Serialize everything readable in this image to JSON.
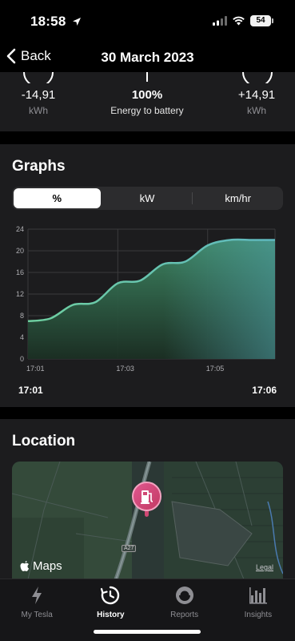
{
  "status_bar": {
    "time": "18:58",
    "battery": "54"
  },
  "nav": {
    "back_label": "Back",
    "title": "30 March 2023"
  },
  "summary": {
    "left": {
      "value": "-14,91",
      "unit": "kWh"
    },
    "center": {
      "value": "100%",
      "label": "Energy to battery"
    },
    "right": {
      "value": "+14,91",
      "unit": "kWh"
    }
  },
  "graphs": {
    "title": "Graphs",
    "segments": [
      "%",
      "kW",
      "km/hr"
    ],
    "selected_segment": "%",
    "range_start": "17:01",
    "range_end": "17:06"
  },
  "chart_data": {
    "type": "area",
    "x": [
      "17:01",
      "17:01:30",
      "17:02",
      "17:02:30",
      "17:03",
      "17:03:30",
      "17:04",
      "17:04:30",
      "17:05",
      "17:05:30",
      "17:06",
      "17:06:30"
    ],
    "values": [
      7,
      7.5,
      10,
      10.5,
      14,
      14.5,
      17.5,
      18,
      21,
      22,
      22,
      22
    ],
    "x_ticks": [
      "17:01",
      "17:03",
      "17:05"
    ],
    "y_ticks": [
      "0",
      "4",
      "8",
      "12",
      "16",
      "20",
      "24"
    ],
    "ylim": [
      0,
      24
    ],
    "grid": true,
    "colors": {
      "line": "#6fd0a0",
      "fill_top": "#3f8a66",
      "fill_bottom": "#1b2f23",
      "right_tint": "#4fa0a8"
    }
  },
  "location": {
    "title": "Location",
    "maps_label": "Maps",
    "legal_label": "Legal",
    "road_label": "A27"
  },
  "tabs": [
    {
      "label": "My Tesla",
      "icon": "bolt-icon",
      "active": false
    },
    {
      "label": "History",
      "icon": "history-icon",
      "active": true
    },
    {
      "label": "Reports",
      "icon": "reports-icon",
      "active": false
    },
    {
      "label": "Insights",
      "icon": "insights-icon",
      "active": false
    }
  ]
}
